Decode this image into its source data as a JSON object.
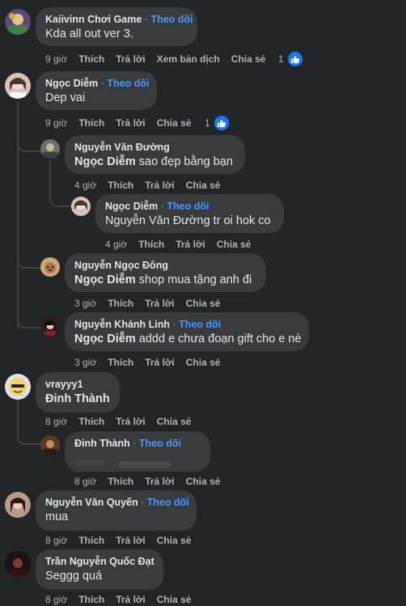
{
  "common": {
    "reply": "Trả lời",
    "like": "Thích",
    "share": "Chia sẻ",
    "follow": "Theo dõi",
    "translate": "Xem bản dịch",
    "sep": " · "
  },
  "comments": [
    {
      "name": "Kaiivinn Chơi Game",
      "text": "Kda all out ver 3.",
      "time": "9 giờ",
      "reactions": "1"
    },
    {
      "name": "Ngọc Diễm",
      "text": "Dep vai",
      "time": "9 giờ",
      "reactions": "1"
    },
    {
      "name": "Nguyễn Văn Đường",
      "mention": "Ngọc Diễm",
      "text": " sao đẹp bằng bạn",
      "time": "4 giờ"
    },
    {
      "name": "Ngọc Diễm",
      "text": "Nguyễn Văn Đường tr oi hok co",
      "time": "4 giờ"
    },
    {
      "name": "Nguyễn Ngọc Đông",
      "mention": "Ngọc Diễm",
      "text": " shop mua tặng anh đi",
      "time": "3 giờ"
    },
    {
      "name": "Nguyễn Khánh Linh",
      "mention": "Ngọc Diễm",
      "text": " addd e chưa đoạn gift cho e nè",
      "time": "3 giờ"
    },
    {
      "name": "vrayyy1",
      "mention": "Đinh Thành",
      "time": "8 giờ"
    },
    {
      "name": "Đinh Thành",
      "time": "8 giờ"
    },
    {
      "name": "Nguyễn Văn Quyến",
      "text": "mua",
      "time": "8 giờ"
    },
    {
      "name": "Trần Nguyễn Quốc Đạt",
      "text": "Seggg quá",
      "time": "8 giờ"
    }
  ]
}
